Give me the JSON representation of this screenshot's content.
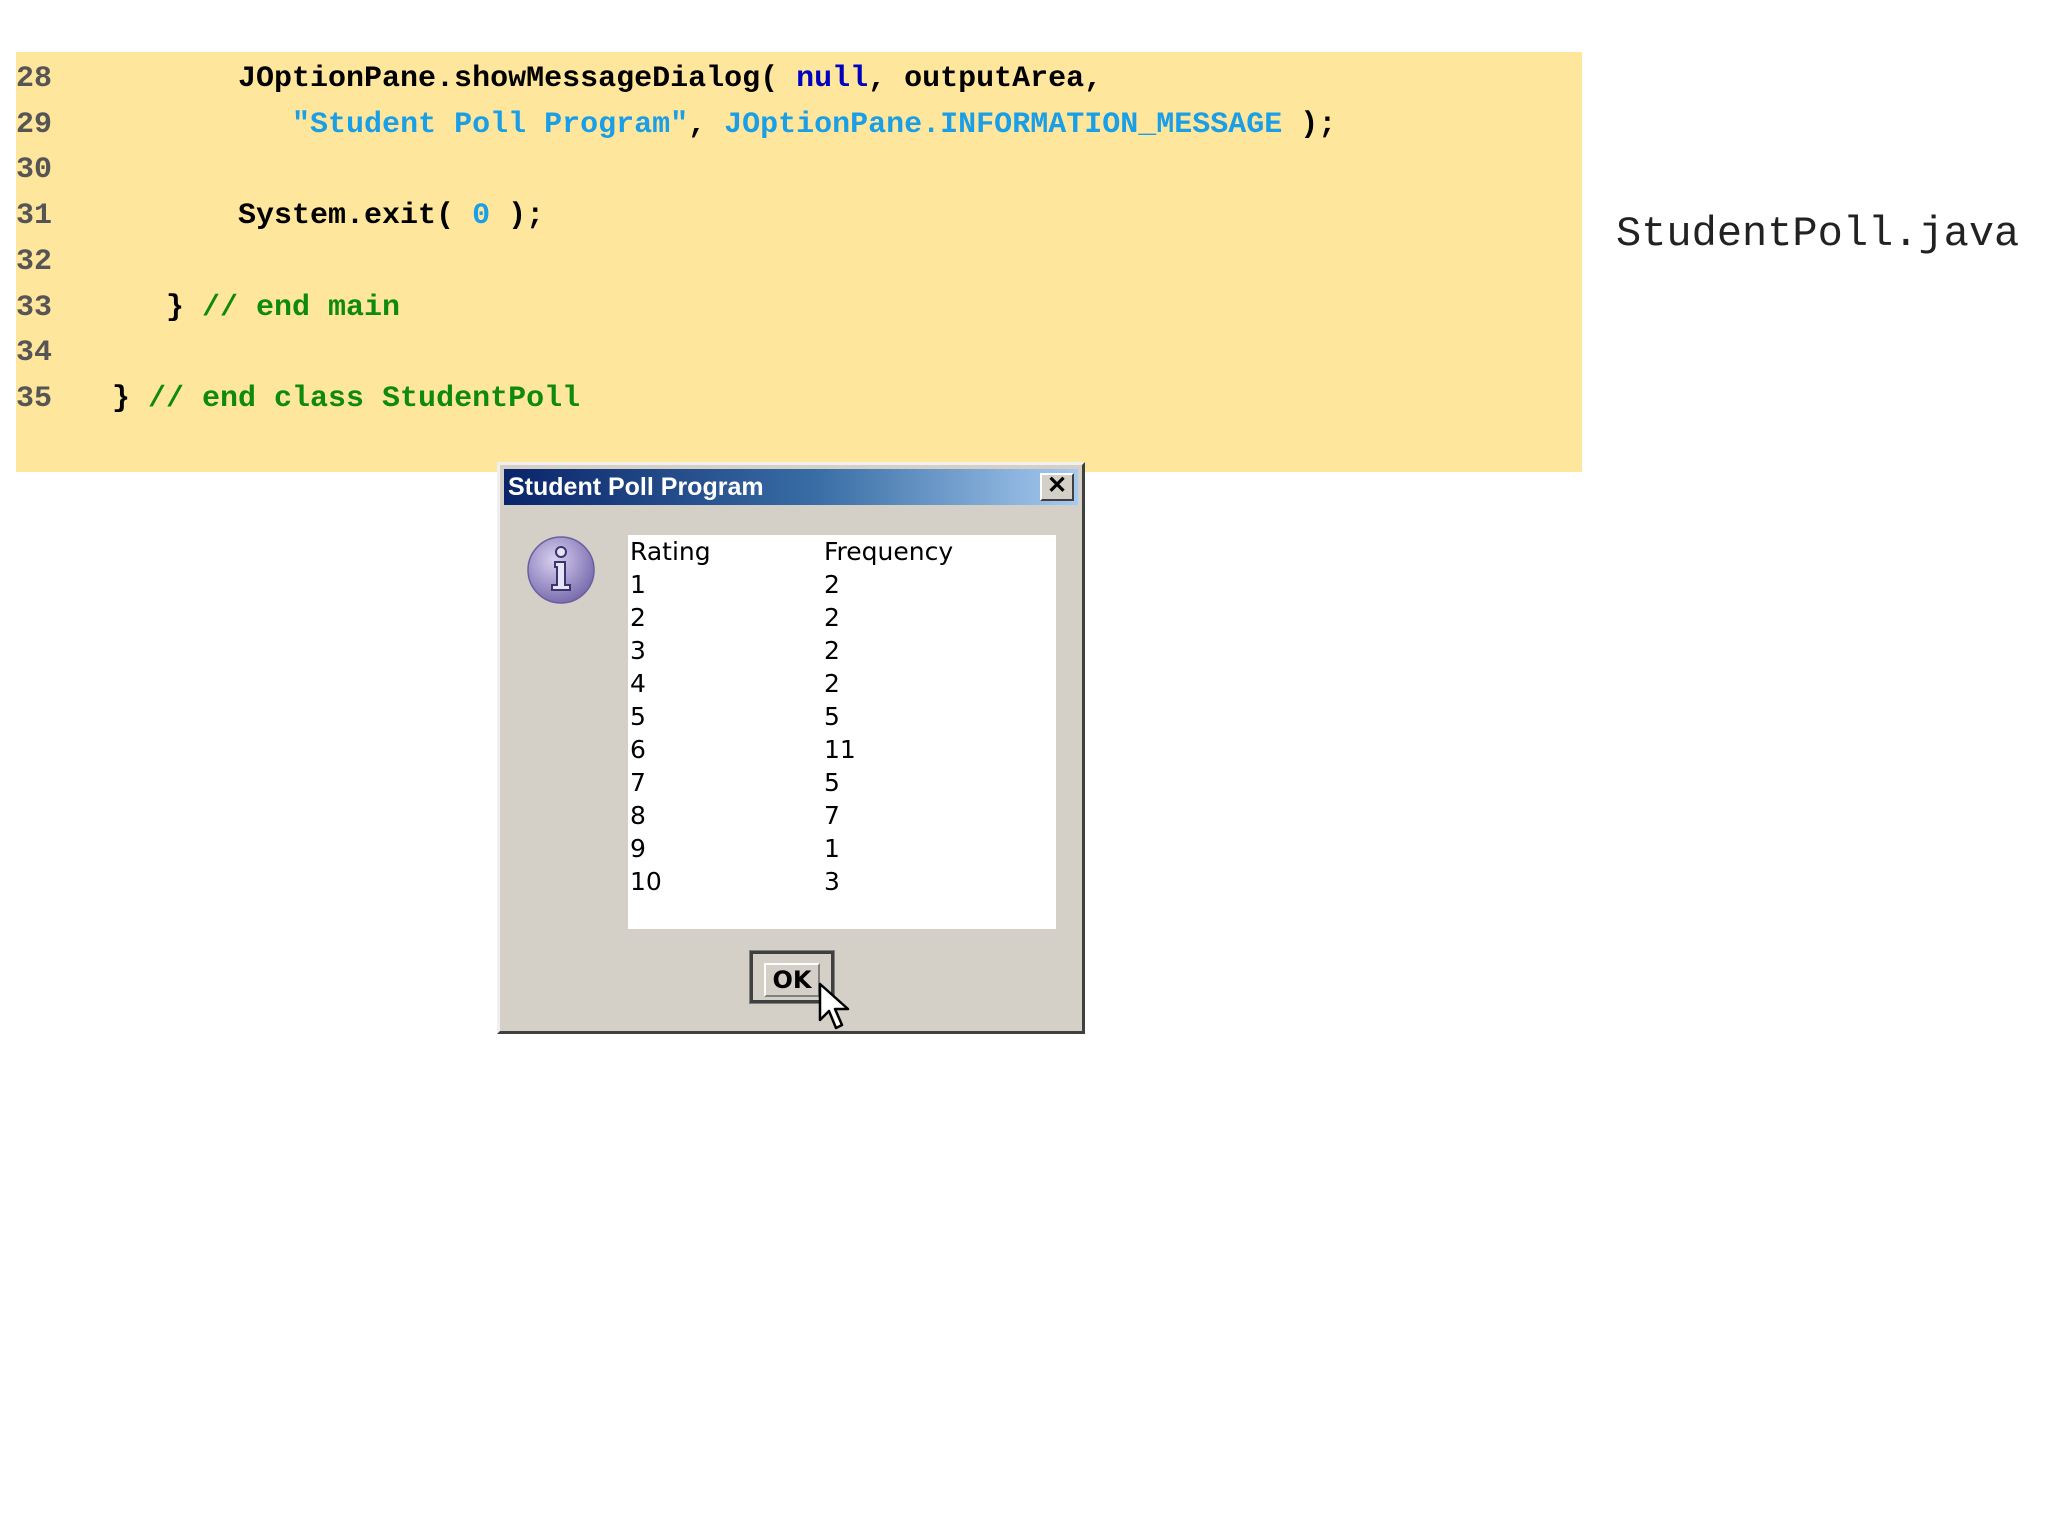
{
  "code": {
    "lines": [
      {
        "num": "28",
        "segments": [
          {
            "type": "plain",
            "text": "         JOptionPane.showMessageDialog( "
          },
          {
            "type": "keyword",
            "text": "null"
          },
          {
            "type": "plain",
            "text": ", outputArea,"
          }
        ]
      },
      {
        "num": "29",
        "segments": [
          {
            "type": "plain",
            "text": "            "
          },
          {
            "type": "literal",
            "text": "\"Student Poll Program\""
          },
          {
            "type": "plain",
            "text": ", "
          },
          {
            "type": "literal",
            "text": "JOptionPane.INFORMATION_MESSAGE"
          },
          {
            "type": "plain",
            "text": " );"
          }
        ]
      },
      {
        "num": "30",
        "segments": []
      },
      {
        "num": "31",
        "segments": [
          {
            "type": "plain",
            "text": "         System.exit( "
          },
          {
            "type": "literal",
            "text": "0"
          },
          {
            "type": "plain",
            "text": " );"
          }
        ]
      },
      {
        "num": "32",
        "segments": []
      },
      {
        "num": "33",
        "segments": [
          {
            "type": "plain",
            "text": "     } "
          },
          {
            "type": "comment",
            "text": "// end main"
          }
        ]
      },
      {
        "num": "34",
        "segments": []
      },
      {
        "num": "35",
        "segments": [
          {
            "type": "plain",
            "text": "  } "
          },
          {
            "type": "comment",
            "text": "// end class StudentPoll"
          }
        ]
      }
    ]
  },
  "file_label": "StudentPoll.java",
  "dialog": {
    "title": "Student Poll Program",
    "close_symbol": "✕",
    "output": {
      "header": {
        "rating": "Rating",
        "frequency": "Frequency"
      },
      "rows": [
        {
          "rating": "1",
          "frequency": "2"
        },
        {
          "rating": "2",
          "frequency": "2"
        },
        {
          "rating": "3",
          "frequency": "2"
        },
        {
          "rating": "4",
          "frequency": "2"
        },
        {
          "rating": "5",
          "frequency": "5"
        },
        {
          "rating": "6",
          "frequency": "11"
        },
        {
          "rating": "7",
          "frequency": "5"
        },
        {
          "rating": "8",
          "frequency": "7"
        },
        {
          "rating": "9",
          "frequency": "1"
        },
        {
          "rating": "10",
          "frequency": "3"
        }
      ]
    },
    "ok_label": "OK",
    "icon": "information-icon"
  },
  "colors": {
    "code_background": "#ffe69d",
    "keyword": "#0000c0",
    "literal": "#1a9ee6",
    "comment": "#0f8a0f",
    "titlebar_start": "#0a246a",
    "titlebar_end": "#a6caf0",
    "dialog_face": "#d4d0c8"
  }
}
